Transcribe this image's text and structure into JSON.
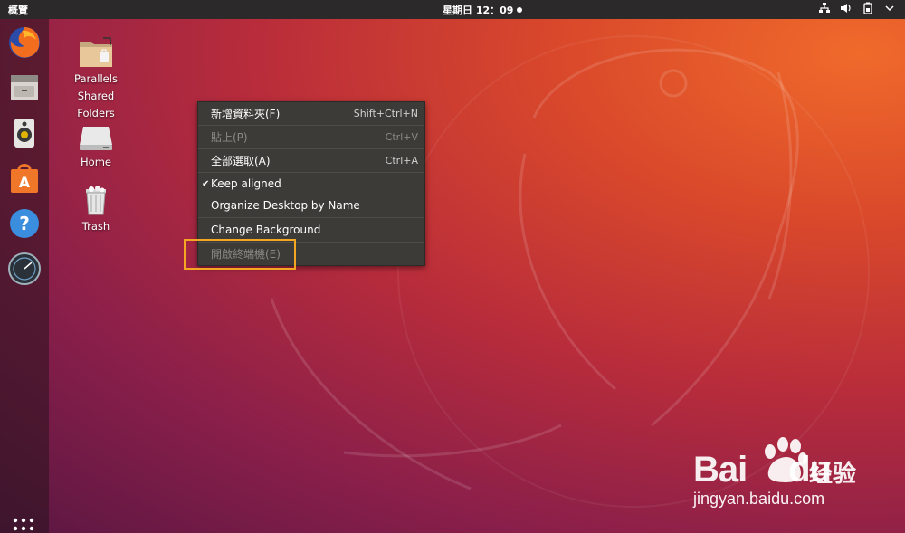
{
  "topbar": {
    "activities_label": "概覽",
    "clock": "星期日 12：09",
    "tray_icons": [
      "network-icon",
      "volume-icon",
      "battery-icon",
      "power-menu-icon"
    ]
  },
  "dock": {
    "apps": [
      {
        "name": "firefox-icon"
      },
      {
        "name": "files-icon"
      },
      {
        "name": "rhythmbox-icon"
      },
      {
        "name": "software-center-icon"
      },
      {
        "name": "help-icon"
      },
      {
        "name": "parallels-tools-icon"
      }
    ],
    "show_apps_icon": "apps-grid-icon"
  },
  "desktop_icons": [
    {
      "line1": "Parallels",
      "line2": "Shared",
      "line3": "Folders",
      "icon": "shared-folder-icon"
    },
    {
      "label": "Home",
      "icon": "home-drive-icon"
    },
    {
      "label": "Trash",
      "icon": "trash-icon"
    }
  ],
  "context_menu": {
    "items": [
      {
        "label": "新增資料夾(F)",
        "accel": "Shift+Ctrl+N",
        "enabled": true
      },
      {
        "label": "貼上(P)",
        "accel": "Ctrl+V",
        "enabled": false
      },
      {
        "label": "全部選取(A)",
        "accel": "Ctrl+A",
        "enabled": true
      },
      {
        "label": "Keep aligned",
        "accel": "",
        "enabled": true,
        "checked": true
      },
      {
        "label": "Organize Desktop by Name",
        "accel": "",
        "enabled": true
      },
      {
        "label": "Change Background",
        "accel": "",
        "enabled": true
      },
      {
        "label": "開啟終端機(E)",
        "accel": "",
        "enabled": true
      }
    ]
  },
  "watermark": {
    "brand": "Bai",
    "brand_suffix": "du",
    "chinese": "经验",
    "url": "jingyan.baidu.com"
  },
  "colors": {
    "accent_highlight": "#f5a623",
    "menu_bg": "#3c3b37",
    "topbar_bg": "#2b2929"
  }
}
